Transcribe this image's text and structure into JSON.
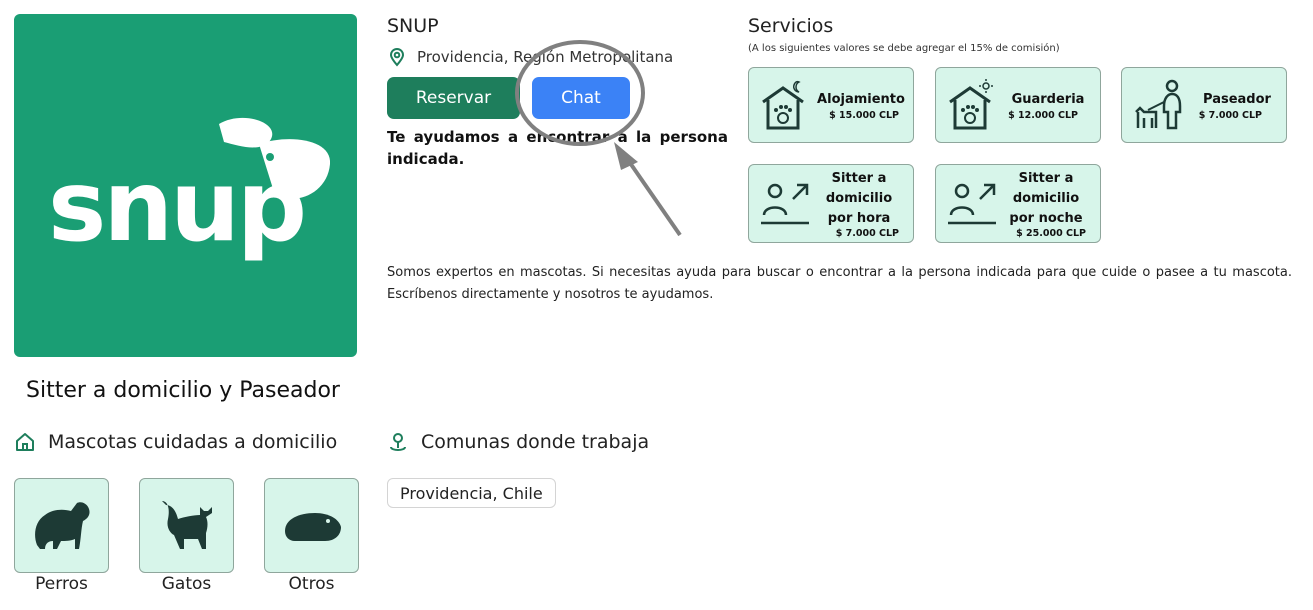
{
  "profile": {
    "name": "SNUP",
    "location": "Providencia, Región Metropolitana",
    "logo_text": "snup",
    "subtitle": "Sitter a domicilio y Paseador",
    "help_text": "Te ayudamos a encontrar a la persona indicada.",
    "description": "Somos expertos en mascotas. Si necesitas ayuda para buscar o encontrar a la persona indicada para que cuide o pasee a tu mascota. Escríbenos directamente y nosotros te ayudamos.",
    "brand_color": "#1a9e74"
  },
  "actions": {
    "reserve_label": "Reservar",
    "chat_label": "Chat",
    "reserve_color": "#1e7e5c",
    "chat_color": "#3b82f6"
  },
  "services": {
    "title": "Servicios",
    "note": "(A los siguientes valores se debe agregar el 15% de comisión)",
    "items": [
      {
        "name": "Alojamiento",
        "price": "$ 15.000 CLP",
        "icon": "house-moon-paw-icon"
      },
      {
        "name": "Guarderia",
        "price": "$ 12.000 CLP",
        "icon": "house-sun-paw-icon"
      },
      {
        "name": "Paseador",
        "price": "$ 7.000 CLP",
        "icon": "walker-dog-icon"
      },
      {
        "name_lines": [
          "Sitter a",
          "domicilio",
          "por hora"
        ],
        "price": "$ 7.000 CLP",
        "icon": "sitter-arrow-icon"
      },
      {
        "name_lines": [
          "Sitter a",
          "domicilio",
          "por noche"
        ],
        "price": "$ 25.000 CLP",
        "icon": "sitter-arrow-icon"
      }
    ]
  },
  "pets": {
    "title": "Mascotas cuidadas a domicilio",
    "items": [
      {
        "label": "Perros",
        "icon": "dog-icon"
      },
      {
        "label": "Gatos",
        "icon": "cat-icon"
      },
      {
        "label": "Otros",
        "icon": "hamster-icon"
      }
    ]
  },
  "communes": {
    "title": "Comunas donde trabaja",
    "items": [
      "Providencia, Chile"
    ]
  }
}
